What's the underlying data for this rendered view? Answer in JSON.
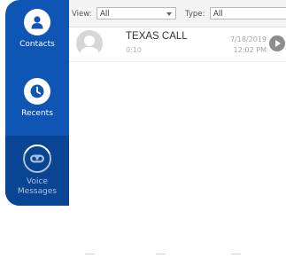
{
  "sidebar": {
    "items": [
      {
        "label": "Contacts",
        "icon": "person-icon"
      },
      {
        "label": "Recents",
        "icon": "clock-icon"
      },
      {
        "label_line1": "Voice",
        "label_line2": "Messages",
        "icon": "voicemail-icon",
        "active": true
      }
    ]
  },
  "filters": {
    "view_label": "View:",
    "view_value": "All",
    "type_label": "Type:",
    "type_value": "All"
  },
  "calls": [
    {
      "caller": "TEXAS CALL",
      "duration": "0:10",
      "date": "7/18/2019",
      "time": "12:02 PM"
    }
  ],
  "colors": {
    "sidebar": "#0f55b4",
    "sidebar_active": "#0a4594",
    "play_button": "#8c8c8c"
  }
}
